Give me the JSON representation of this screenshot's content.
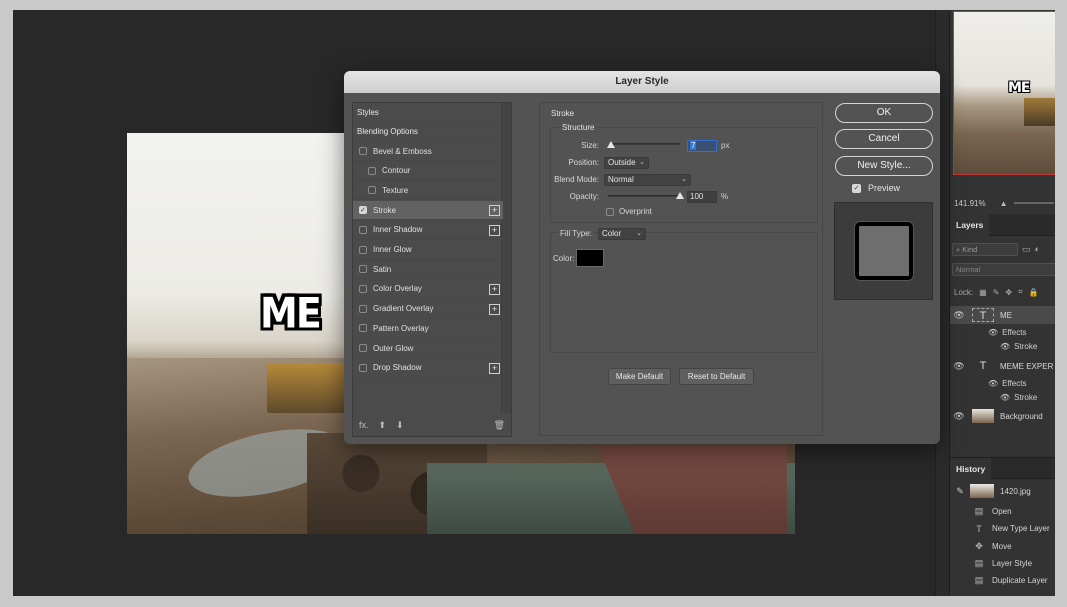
{
  "canvas": {
    "overlay_text": "ME"
  },
  "navigator": {
    "overlay_text": "ME",
    "zoom": "141.91%"
  },
  "layers_panel": {
    "tab": "Layers",
    "kind_placeholder": "Kind",
    "blend_mode": "Normal",
    "lock_label": "Lock:",
    "layers": [
      {
        "name": "ME",
        "type": "text",
        "effects_label": "Effects",
        "effect": "Stroke"
      },
      {
        "name": "MEME EXPER",
        "type": "text",
        "effects_label": "Effects",
        "effect": "Stroke"
      },
      {
        "name": "Background",
        "type": "image"
      }
    ]
  },
  "history_panel": {
    "tab": "History",
    "snapshot": "1420.jpg",
    "items": [
      "Open",
      "New Type Layer",
      "Move",
      "Layer Style",
      "Duplicate Layer"
    ]
  },
  "dialog": {
    "title": "Layer Style",
    "styles_header": "Styles",
    "blending_options": "Blending Options",
    "style_items": [
      {
        "label": "Bevel & Emboss",
        "checked": false,
        "plus": false,
        "sub": false
      },
      {
        "label": "Contour",
        "checked": false,
        "plus": false,
        "sub": true
      },
      {
        "label": "Texture",
        "checked": false,
        "plus": false,
        "sub": true
      },
      {
        "label": "Stroke",
        "checked": true,
        "plus": true,
        "sub": false
      },
      {
        "label": "Inner Shadow",
        "checked": false,
        "plus": true,
        "sub": false
      },
      {
        "label": "Inner Glow",
        "checked": false,
        "plus": false,
        "sub": false
      },
      {
        "label": "Satin",
        "checked": false,
        "plus": false,
        "sub": false
      },
      {
        "label": "Color Overlay",
        "checked": false,
        "plus": true,
        "sub": false
      },
      {
        "label": "Gradient Overlay",
        "checked": false,
        "plus": true,
        "sub": false
      },
      {
        "label": "Pattern Overlay",
        "checked": false,
        "plus": false,
        "sub": false
      },
      {
        "label": "Outer Glow",
        "checked": false,
        "plus": false,
        "sub": false
      },
      {
        "label": "Drop Shadow",
        "checked": false,
        "plus": true,
        "sub": false
      }
    ],
    "footer_fx": "fx.",
    "stroke": {
      "group_title": "Stroke",
      "structure_title": "Structure",
      "size_label": "Size:",
      "size_value": "7",
      "size_unit": "px",
      "position_label": "Position:",
      "position_value": "Outside",
      "blend_mode_label": "Blend Mode:",
      "blend_mode_value": "Normal",
      "opacity_label": "Opacity:",
      "opacity_value": "100",
      "opacity_unit": "%",
      "overprint_label": "Overprint",
      "fill_type_label": "Fill Type:",
      "fill_type_value": "Color",
      "color_label": "Color:",
      "color_value": "#000000"
    },
    "make_default": "Make Default",
    "reset_default": "Reset to Default",
    "ok": "OK",
    "cancel": "Cancel",
    "new_style": "New Style...",
    "preview_label": "Preview",
    "preview_checked": true
  }
}
